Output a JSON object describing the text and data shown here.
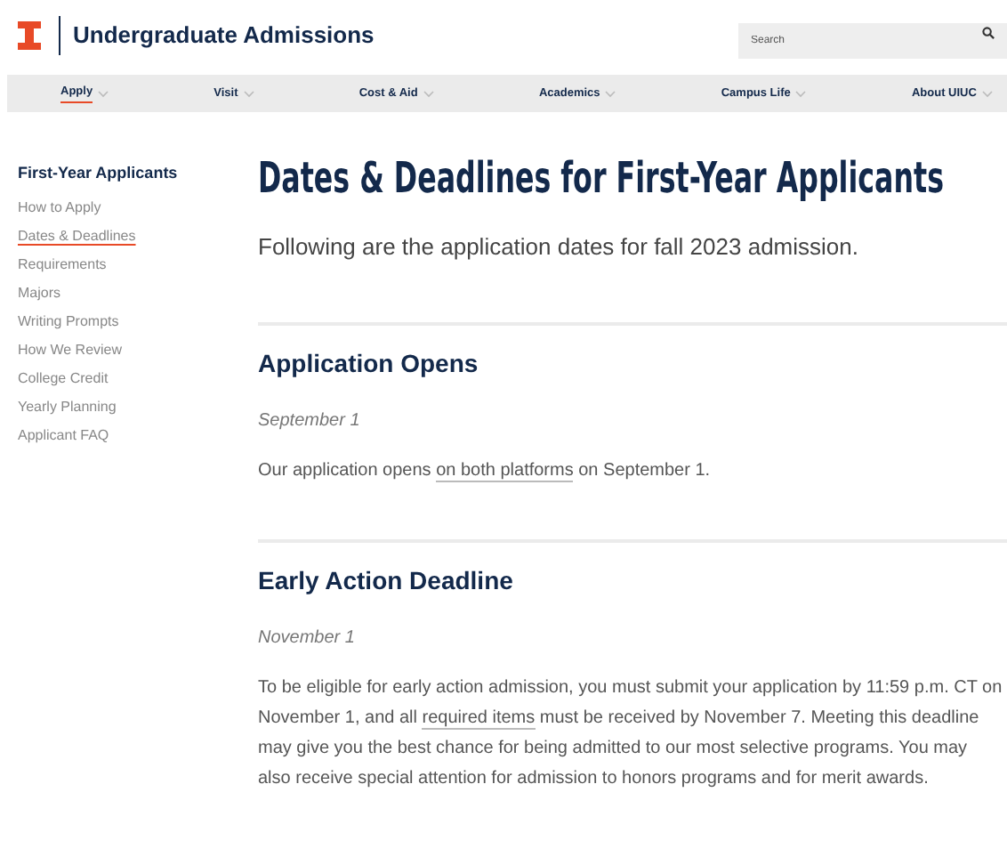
{
  "header": {
    "title": "Undergraduate Admissions",
    "search": {
      "placeholder": "Search"
    }
  },
  "nav": [
    {
      "label": "Apply",
      "selected": true
    },
    {
      "label": "Visit",
      "selected": false
    },
    {
      "label": "Cost & Aid",
      "selected": false
    },
    {
      "label": "Academics",
      "selected": false
    },
    {
      "label": "Campus Life",
      "selected": false
    },
    {
      "label": "About UIUC",
      "selected": false
    }
  ],
  "sidebar": {
    "heading": "First-Year Applicants",
    "items": [
      {
        "label": "How to Apply",
        "selected": false
      },
      {
        "label": "Dates & Deadlines",
        "selected": true
      },
      {
        "label": "Requirements",
        "selected": false
      },
      {
        "label": "Majors",
        "selected": false
      },
      {
        "label": "Writing Prompts",
        "selected": false
      },
      {
        "label": "How We Review",
        "selected": false
      },
      {
        "label": "College Credit",
        "selected": false
      },
      {
        "label": "Yearly Planning",
        "selected": false
      },
      {
        "label": "Applicant FAQ",
        "selected": false
      }
    ]
  },
  "page_title": "Dates & Deadlines for First-Year Applicants",
  "intro": "Following are the application dates for fall 2023 admission.",
  "sections": [
    {
      "heading": "Application Opens",
      "date": "September 1",
      "paragraph": [
        {
          "kind": "text",
          "text": "Our application opens "
        },
        {
          "kind": "link",
          "text": "on both platforms"
        },
        {
          "kind": "text",
          "text": " on September 1."
        }
      ]
    },
    {
      "heading": "Early Action Deadline",
      "date": "November 1",
      "paragraph": [
        {
          "kind": "text",
          "text": "To be eligible for early action admission, you must submit your application by 11:59 p.m. CT on November 1, and all "
        },
        {
          "kind": "link",
          "text": "required items"
        },
        {
          "kind": "text",
          "text": " must be received by November 7. Meeting this deadline may give you the best chance for being admitted to our most selective programs. You may also receive special attention for admission to honors programs and for merit awards."
        }
      ]
    }
  ]
}
